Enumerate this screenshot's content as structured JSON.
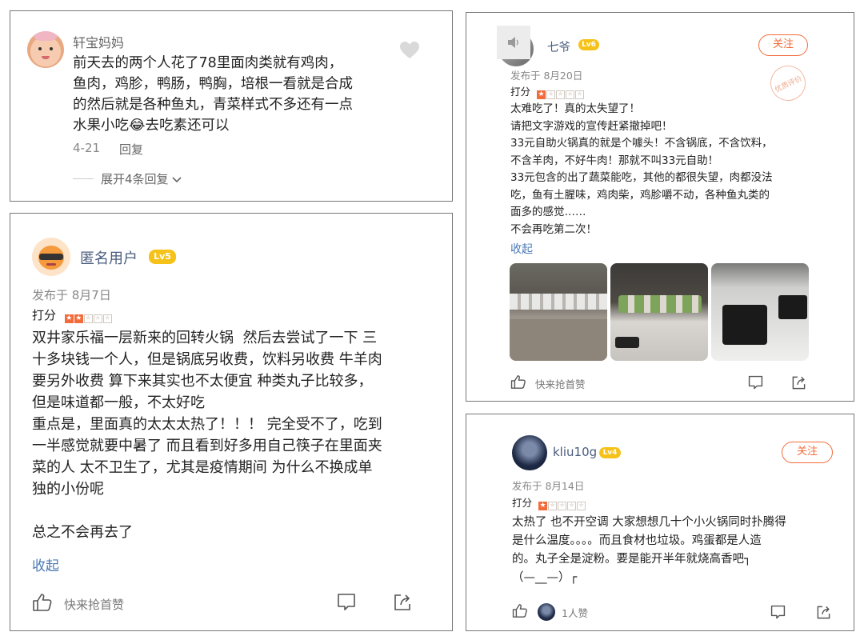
{
  "card1": {
    "username": "轩宝妈妈",
    "text": "前天去的两个人花了78里面肉类就有鸡肉，\n鱼肉，鸡胗，鸭肠，鸭胸，培根一看就是合成\n的然后就是各种鱼丸，青菜样式不多还有一点\n水果小吃😂去吃素还可以",
    "date": "4-21",
    "reply_label": "回复",
    "expand_label": "展开4条回复"
  },
  "card2": {
    "username": "匿名用户",
    "level": "Lv5",
    "posted": "发布于 8月7日",
    "score_label": "打分",
    "rating": 2,
    "text": "双井家乐福一层新来的回转火锅  然后去尝试了一下 三\n十多块钱一个人，但是锅底另收费，饮料另收费 牛羊肉\n要另外收费 算下来其实也不太便宜 种类丸子比较多，\n但是味道都一般，不太好吃\n重点是，里面真的太太太热了！！！ 完全受不了，吃到\n一半感觉就要中暑了 而且看到好多用自己筷子在里面夹\n菜的人 太不卫生了，尤其是疫情期间 为什么不换成单\n独的小份呢\n\n总之不会再去了",
    "collapse": "收起",
    "like_prompt": "快来抢首赞"
  },
  "card3": {
    "username": "七爷",
    "level": "Lv6",
    "follow": "关注",
    "stamp": "优质评价",
    "posted": "发布于 8月20日",
    "score_label": "打分",
    "rating": 1,
    "text": "太难吃了！真的太失望了！\n请把文字游戏的宣传赶紧撤掉吧！\n33元自助火锅真的就是个噱头！不含锅底，不含饮料，\n不含羊肉，不好牛肉！那就不叫33元自助！\n33元包含的出了蔬菜能吃，其他的都很失望，肉都没法\n吃，鱼有土腥味，鸡肉柴，鸡胗嚼不动，各种鱼丸类的\n面多的感觉……\n不会再吃第二次！",
    "collapse": "收起",
    "like_prompt": "快来抢首赞"
  },
  "card4": {
    "username": "kliu10g",
    "level": "Lv4",
    "follow": "关注",
    "posted": "发布于 8月14日",
    "score_label": "打分",
    "rating": 1,
    "text": "太热了 也不开空调 大家想想几十个小火锅同时扑腾得\n是什么温度。。。。而且食材也垃圾。鸡蛋都是人造\n的。丸子全是淀粉。要是能开半年就烧高香吧┐\n（—__—）┌",
    "likes": "1人赞"
  },
  "colors": {
    "accent": "#f26b3a",
    "link": "#4a78b3",
    "name": "#4a5d7e",
    "badge": "#f5c21a"
  },
  "icons": [
    "heart-icon",
    "thumbs-up-icon",
    "comment-icon",
    "share-icon",
    "chevron-down-icon",
    "speaker-icon"
  ]
}
